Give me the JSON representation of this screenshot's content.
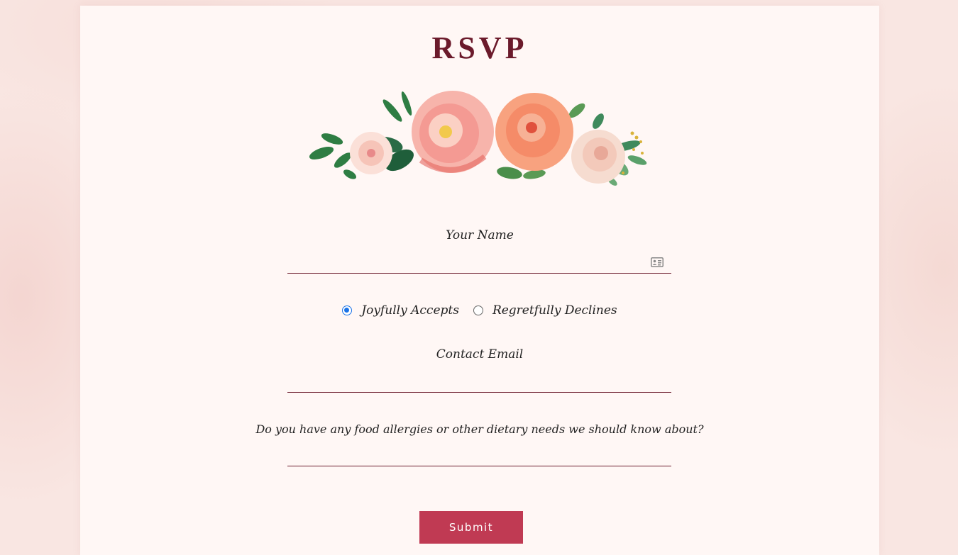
{
  "page": {
    "title": "RSVP"
  },
  "form": {
    "name_label": "Your Name",
    "name_value": "",
    "attendance": {
      "options": [
        {
          "label": "Joyfully Accepts",
          "selected": true
        },
        {
          "label": "Regretfully Declines",
          "selected": false
        }
      ]
    },
    "email_label": "Contact Email",
    "email_value": "",
    "dietary_label": "Do you have any food allergies or other dietary needs we should know about?",
    "dietary_value": "",
    "submit_label": "Submit"
  },
  "icons": {
    "name_field_icon": "contact-card-icon",
    "header_decoration": "floral-arrangement-illustration"
  },
  "colors": {
    "title": "#6b1a2b",
    "accent": "#c03a53",
    "field_underline": "#6b1a2b",
    "radio_selected": "#1a73e8",
    "card_background": "#fff7f5",
    "page_background": "#f9e6e2"
  }
}
